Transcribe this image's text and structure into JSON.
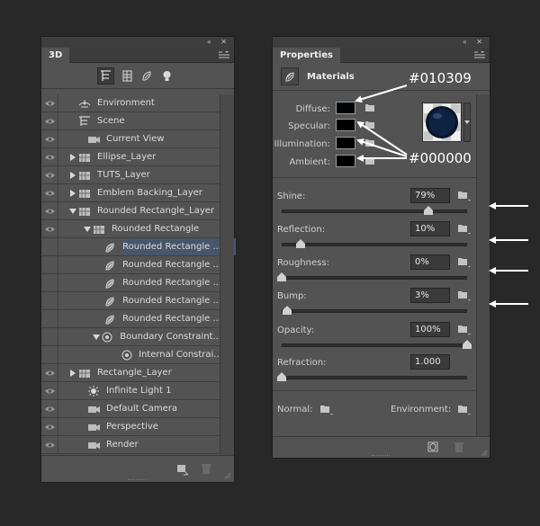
{
  "panel3d": {
    "tab": "3D",
    "tools": [
      "scene-filter-icon",
      "mesh-filter-icon",
      "material-filter-icon",
      "light-filter-icon"
    ],
    "items": [
      {
        "label": "Environment",
        "icon": "environment-icon",
        "eye": true
      },
      {
        "label": "Scene",
        "icon": "scene-icon",
        "eye": true
      },
      {
        "label": "Current View",
        "icon": "camera-icon",
        "eye": true
      },
      {
        "label": "Ellipse_Layer",
        "icon": "mesh-icon",
        "eye": true,
        "expand": "collapsed"
      },
      {
        "label": "TUTS_Layer",
        "icon": "mesh-icon",
        "eye": true,
        "expand": "collapsed"
      },
      {
        "label": "Emblem Backing_Layer",
        "icon": "mesh-icon",
        "eye": true,
        "expand": "collapsed"
      },
      {
        "label": "Rounded Rectangle_Layer",
        "icon": "mesh-icon",
        "eye": true,
        "expand": "expanded"
      },
      {
        "label": "Rounded Rectangle",
        "icon": "mesh-icon",
        "eye": true,
        "expand": "expanded"
      },
      {
        "label": "Rounded Rectangle ...",
        "icon": "material-icon",
        "eye": false,
        "selected": true
      },
      {
        "label": "Rounded Rectangle ...",
        "icon": "material-icon",
        "eye": false
      },
      {
        "label": "Rounded Rectangle ...",
        "icon": "material-icon",
        "eye": false
      },
      {
        "label": "Rounded Rectangle ...",
        "icon": "material-icon",
        "eye": false
      },
      {
        "label": "Rounded Rectangle ...",
        "icon": "material-icon",
        "eye": false
      },
      {
        "label": "Boundary Constraint...",
        "icon": "constraint-icon",
        "eye": false,
        "expand": "expanded"
      },
      {
        "label": "Internal Constrai...",
        "icon": "constraint-icon",
        "eye": false
      },
      {
        "label": "Rectangle_Layer",
        "icon": "mesh-icon",
        "eye": true,
        "expand": "collapsed"
      },
      {
        "label": "Infinite Light 1",
        "icon": "light-icon",
        "eye": true
      },
      {
        "label": "Default Camera",
        "icon": "camera-icon",
        "eye": true
      },
      {
        "label": "Perspective",
        "icon": "camera-icon",
        "eye": true
      },
      {
        "label": "Render",
        "icon": "camera-icon",
        "eye": true
      }
    ]
  },
  "properties": {
    "tab": "Properties",
    "section_title": "Materials",
    "swatches": [
      {
        "label": "Diffuse:",
        "color": "#010309"
      },
      {
        "label": "Specular:",
        "color": "#000000"
      },
      {
        "label": "Illumination:",
        "color": "#000000"
      },
      {
        "label": "Ambient:",
        "color": "#000000"
      }
    ],
    "sliders": [
      {
        "label": "Shine:",
        "value": "79%",
        "fraction": 0.79
      },
      {
        "label": "Reflection:",
        "value": "10%",
        "fraction": 0.1
      },
      {
        "label": "Roughness:",
        "value": "0%",
        "fraction": 0.0
      },
      {
        "label": "Bump:",
        "value": "3%",
        "fraction": 0.03
      },
      {
        "label": "Opacity:",
        "value": "100%",
        "fraction": 1.0
      },
      {
        "label": "Refraction:",
        "value": "1.000",
        "fraction": 0.0
      }
    ],
    "normal_label": "Normal:",
    "environment_label": "Environment:"
  },
  "annotations": {
    "diffuse_color": "#010309",
    "other_color": "#000000"
  }
}
